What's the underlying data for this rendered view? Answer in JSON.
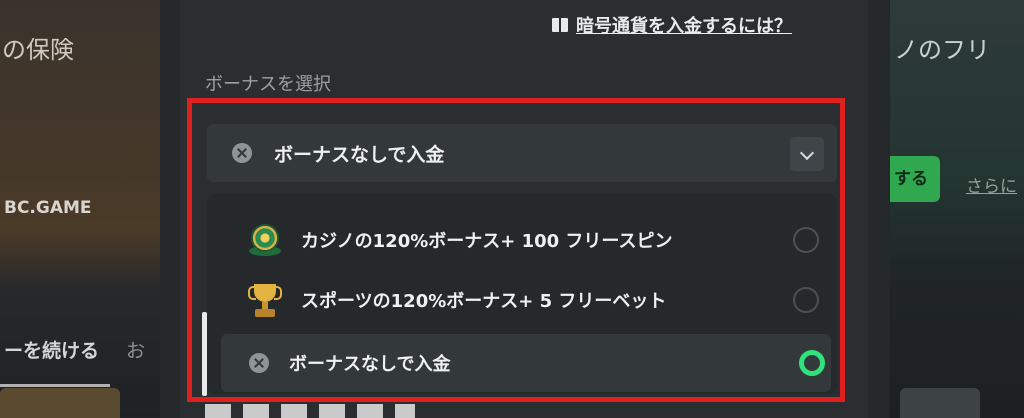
{
  "background": {
    "left": {
      "promo_text": "の保険",
      "logo_text": "BC.GAME",
      "continue_tab": "ーを続ける",
      "other_tab": "お"
    },
    "right": {
      "promo_text": "ノのフリ",
      "button_label": "する",
      "more_link": "さらに"
    }
  },
  "modal": {
    "help_link": "暗号通貨を入金するには？",
    "section_label": "ボーナスを選択",
    "selected_value": "ボーナスなしで入金",
    "options": [
      {
        "label": "カジノの120%ボーナス+ 100 フリースピン",
        "icon": "roulette-icon",
        "selected": false
      },
      {
        "label": "スポーツの120%ボーナス+ 5 フリーベット",
        "icon": "trophy-icon",
        "selected": false
      },
      {
        "label": "ボーナスなしで入金",
        "icon": "close-circle-icon",
        "selected": true
      }
    ]
  },
  "colors": {
    "highlight_frame": "#e01f1f",
    "radio_selected": "#2de37a",
    "accent_green": "#2fa84f"
  }
}
